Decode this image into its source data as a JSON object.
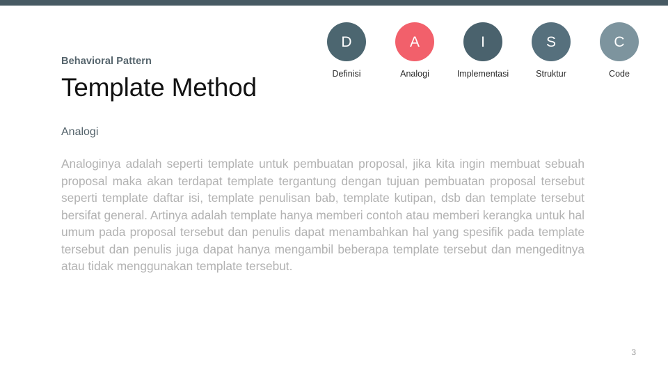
{
  "theme": {
    "top_bar_color": "#475a63",
    "accent_active_color": "#f2606b",
    "background_color": "#ffffff",
    "heading_color": "#55646c",
    "body_text_color": "#b2b2b2"
  },
  "header": {
    "eyebrow": "Behavioral Pattern",
    "title": "Template Method"
  },
  "nav": {
    "steps": [
      {
        "initial": "D",
        "label": "Definisi",
        "color": "#4c6670",
        "active": false
      },
      {
        "initial": "A",
        "label": "Analogi",
        "color": "#f2606b",
        "active": true
      },
      {
        "initial": "I",
        "label": "Implementasi",
        "color": "#4a626d",
        "active": false
      },
      {
        "initial": "S",
        "label": "Struktur",
        "color": "#56707d",
        "active": false
      },
      {
        "initial": "C",
        "label": "Code",
        "color": "#7d949e",
        "active": false
      }
    ]
  },
  "content": {
    "section_heading": "Analogi",
    "paragraph": "Analoginya adalah seperti template untuk pembuatan proposal, jika kita ingin membuat sebuah proposal maka akan terdapat template tergantung dengan tujuan pembuatan proposal tersebut seperti template daftar isi, template penulisan bab, template kutipan, dsb dan template tersebut bersifat general. Artinya adalah template hanya memberi contoh atau memberi kerangka untuk hal umum pada proposal tersebut dan penulis dapat menambahkan hal yang spesifik pada template tersebut dan penulis juga dapat hanya mengambil beberapa template tersebut dan mengeditnya atau tidak menggunakan template tersebut."
  },
  "footer": {
    "page_number": "3"
  }
}
